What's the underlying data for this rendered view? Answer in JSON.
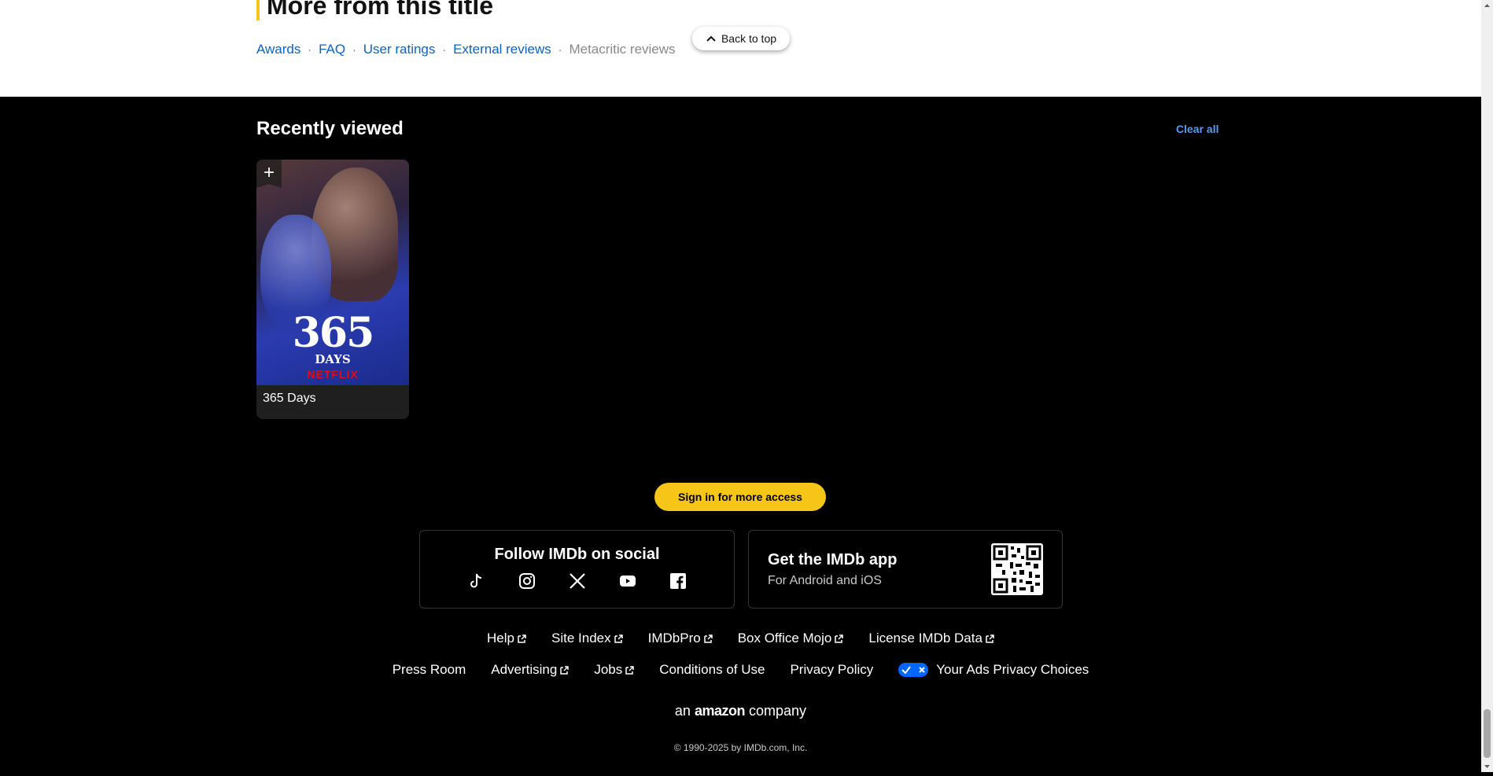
{
  "more_from_title": {
    "heading": "More from this title",
    "links": [
      {
        "label": "Awards",
        "enabled": true
      },
      {
        "label": "FAQ",
        "enabled": true
      },
      {
        "label": "User ratings",
        "enabled": true
      },
      {
        "label": "External reviews",
        "enabled": true
      },
      {
        "label": "Metacritic reviews",
        "enabled": false
      }
    ],
    "separator": "·"
  },
  "back_to_top": {
    "label": "Back to top",
    "icon": "chevron-up-icon"
  },
  "recently_viewed": {
    "title": "Recently viewed",
    "clear_label": "Clear all",
    "items": [
      {
        "title": "365 Days",
        "poster_number": "365",
        "poster_word": "DAYS",
        "poster_brand": "NETFLIX",
        "add_icon": "+"
      }
    ]
  },
  "signin": {
    "label": "Sign in for more access"
  },
  "social": {
    "title": "Follow IMDb on social",
    "icons": [
      "tiktok-icon",
      "instagram-icon",
      "x-icon",
      "youtube-icon",
      "facebook-icon"
    ]
  },
  "app": {
    "title": "Get the IMDb app",
    "subtitle": "For Android and iOS"
  },
  "footer_links_row1": [
    {
      "label": "Help",
      "external": true
    },
    {
      "label": "Site Index",
      "external": true
    },
    {
      "label": "IMDbPro",
      "external": true
    },
    {
      "label": "Box Office Mojo",
      "external": true
    },
    {
      "label": "License IMDb Data",
      "external": true
    }
  ],
  "footer_links_row2": [
    {
      "label": "Press Room",
      "external": false
    },
    {
      "label": "Advertising",
      "external": true
    },
    {
      "label": "Jobs",
      "external": true
    },
    {
      "label": "Conditions of Use",
      "external": false
    },
    {
      "label": "Privacy Policy",
      "external": false
    },
    {
      "label": "Your Ads Privacy Choices",
      "external": false
    }
  ],
  "amazon": {
    "prefix": "an",
    "brand": "amazon",
    "suffix": "company"
  },
  "copyright": "© 1990-2025 by IMDb.com, Inc.",
  "colors": {
    "accent": "#f5c518",
    "link": "#0e63be",
    "dark_link": "#5799ef",
    "background": "#000000"
  }
}
